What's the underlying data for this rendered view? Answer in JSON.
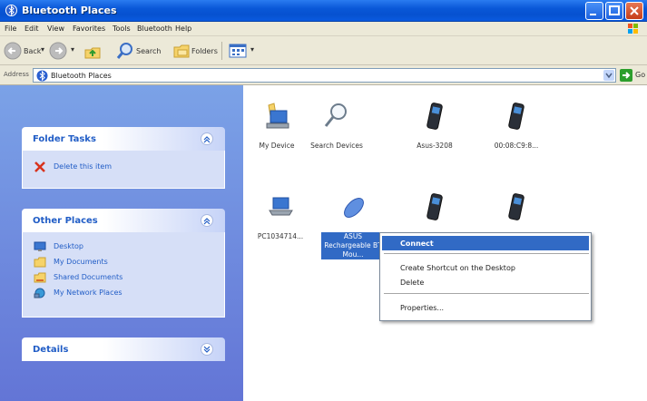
{
  "window": {
    "title": "Bluetooth Places"
  },
  "menubar": {
    "items": [
      "File",
      "Edit",
      "View",
      "Favorites",
      "Tools",
      "Bluetooth",
      "Help"
    ]
  },
  "toolbar": {
    "back": "Back",
    "search": "Search",
    "folders": "Folders"
  },
  "address": {
    "label": "Address",
    "value": "Bluetooth Places",
    "go": "Go"
  },
  "tasks": {
    "folder_tasks": {
      "title": "Folder Tasks",
      "items": [
        "Delete this item"
      ]
    },
    "other_places": {
      "title": "Other Places",
      "items": [
        "Desktop",
        "My Documents",
        "Shared Documents",
        "My Network Places"
      ]
    },
    "details": {
      "title": "Details"
    }
  },
  "content": {
    "items": [
      {
        "label": "My Device",
        "icon": "computer-icon"
      },
      {
        "label": "Search Devices",
        "icon": "magnifier-icon"
      },
      {
        "label": "Asus-3208",
        "icon": "phone-icon"
      },
      {
        "label": "00:08:C9:8...",
        "icon": "phone-icon"
      },
      {
        "label": "PC1034714...",
        "icon": "laptop-icon"
      },
      {
        "label": "ASUS Rechargeable BT Mou...",
        "icon": "mouse-icon"
      },
      {
        "label": "",
        "icon": "phone-icon"
      },
      {
        "label": "",
        "icon": "phone-icon"
      }
    ]
  },
  "context_menu": {
    "items": [
      "Connect",
      "Create Shortcut on the Desktop",
      "Delete",
      "Properties..."
    ]
  },
  "colors": {
    "titlebar": "#0a58d8",
    "selection": "#316ac5",
    "task_link": "#215dc6",
    "pane_bg": "#6f8fe0"
  }
}
